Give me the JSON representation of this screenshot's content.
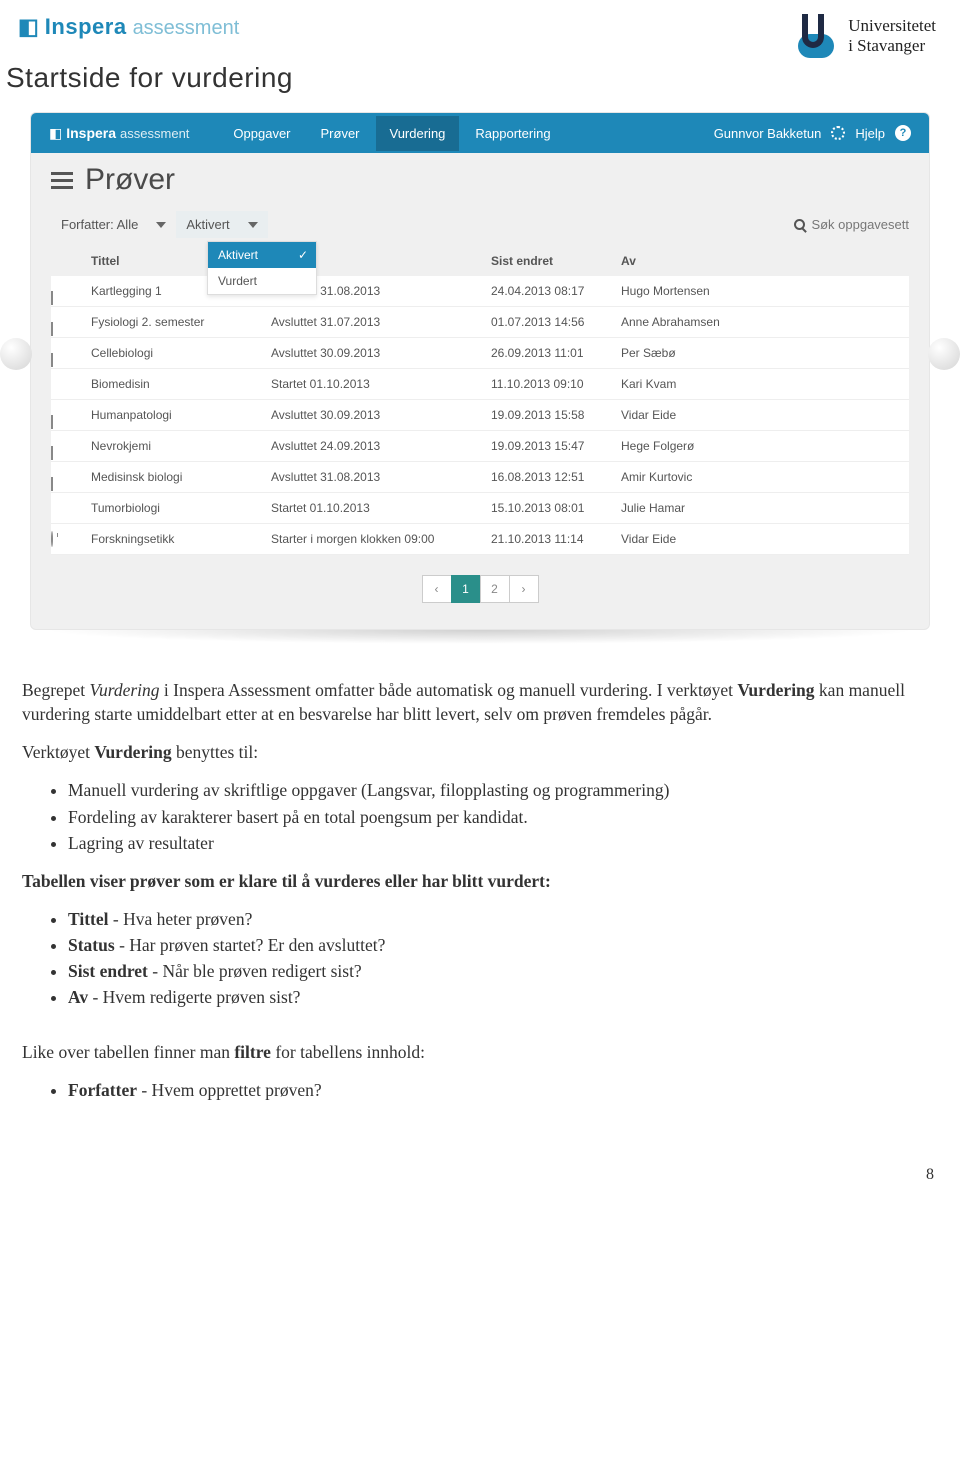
{
  "header": {
    "inspera_name": "Inspera",
    "inspera_sub": "assessment",
    "uis_line1": "Universitetet",
    "uis_line2": "i Stavanger"
  },
  "doc_title": "Startside for vurdering",
  "app": {
    "brand_name": "Inspera",
    "brand_sub": "assessment",
    "nav": {
      "oppgaver": "Oppgaver",
      "prover": "Prøver",
      "vurdering": "Vurdering",
      "rapportering": "Rapportering"
    },
    "user_name": "Gunnvor Bakketun",
    "help": "Hjelp",
    "page_title": "Prøver",
    "filter_author_label": "Forfatter: Alle",
    "filter_status_label": "Aktivert",
    "dropdown_opt1": "Aktivert",
    "dropdown_opt2": "Vurdert",
    "search_placeholder": "Søk oppgavesett",
    "col_title": "Tittel",
    "col_sist": "Sist endret",
    "col_av": "Av",
    "rows": [
      {
        "icon": "flag",
        "title": "Kartlegging 1",
        "status": "Avsluttet 31.08.2013",
        "sist": "24.04.2013 08:17",
        "av": "Hugo Mortensen"
      },
      {
        "icon": "flag",
        "title": "Fysiologi 2. semester",
        "status": "Avsluttet 31.07.2013",
        "sist": "01.07.2013 14:56",
        "av": "Anne Abrahamsen"
      },
      {
        "icon": "flag",
        "title": "Cellebiologi",
        "status": "Avsluttet 30.09.2013",
        "sist": "26.09.2013 11:01",
        "av": "Per Sæbø"
      },
      {
        "icon": "dot",
        "title": "Biomedisin",
        "status": "Startet 01.10.2013",
        "sist": "11.10.2013 09:10",
        "av": "Kari Kvam"
      },
      {
        "icon": "flag",
        "title": "Humanpatologi",
        "status": "Avsluttet 30.09.2013",
        "sist": "19.09.2013 15:58",
        "av": "Vidar Eide"
      },
      {
        "icon": "flag",
        "title": "Nevrokjemi",
        "status": "Avsluttet 24.09.2013",
        "sist": "19.09.2013 15:47",
        "av": "Hege Folgerø"
      },
      {
        "icon": "flag",
        "title": "Medisinsk biologi",
        "status": "Avsluttet 31.08.2013",
        "sist": "16.08.2013 12:51",
        "av": "Amir Kurtovic"
      },
      {
        "icon": "dot",
        "title": "Tumorbiologi",
        "status": "Startet 01.10.2013",
        "sist": "15.10.2013 08:01",
        "av": "Julie Hamar"
      },
      {
        "icon": "clock",
        "title": "Forskningsetikk",
        "status": "Starter i morgen klokken 09:00",
        "sist": "21.10.2013 11:14",
        "av": "Vidar Eide"
      }
    ],
    "page1": "1",
    "page2": "2"
  },
  "text": {
    "p1a": "Begrepet ",
    "p1b": "Vurdering",
    "p1c": " i Inspera Assessment omfatter både automatisk og manuell vurdering. I verktøyet ",
    "p1d": "Vurdering",
    "p1e": " kan manuell vurdering starte umiddelbart etter at en besvarelse har blitt levert, selv om prøven fremdeles pågår.",
    "p2a": "Verktøyet ",
    "p2b": "Vurdering",
    "p2c": " benyttes til:",
    "u1_1": "Manuell vurdering av skriftlige oppgaver (Langsvar, filopplasting og programmering)",
    "u1_2": "Fordeling av karakterer basert på en total poengsum per kandidat.",
    "u1_3": "Lagring av resultater",
    "p3": "Tabellen viser prøver som er klare til å vurderes eller har blitt vurdert:",
    "u2_1a": "Tittel",
    "u2_1b": " - Hva heter prøven?",
    "u2_2a": "Status",
    "u2_2b": " - Har prøven startet? Er den avsluttet?",
    "u2_3a": "Sist endret",
    "u2_3b": " - Når ble prøven redigert sist?",
    "u2_4a": "Av",
    "u2_4b": " - Hvem redigerte prøven sist?",
    "p4a": "Like over tabellen finner man ",
    "p4b": "filtre",
    "p4c": " for tabellens innhold:",
    "u3_1a": "Forfatter",
    "u3_1b": " - Hvem opprettet prøven?"
  },
  "page_number": "8"
}
